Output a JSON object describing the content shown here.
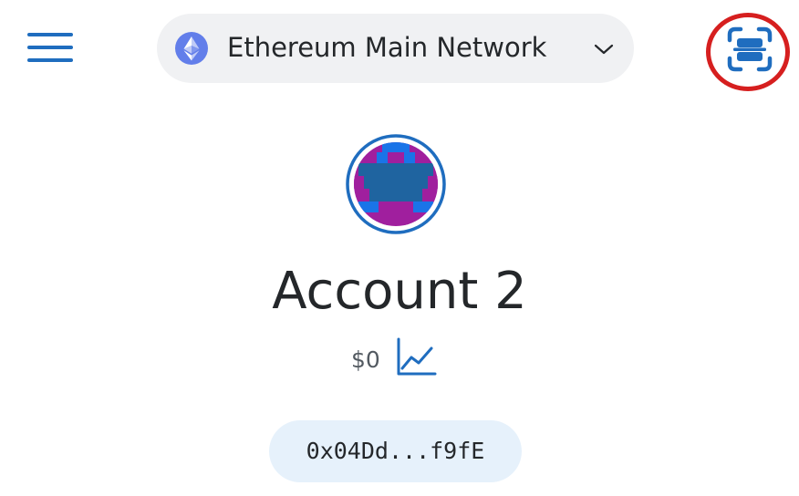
{
  "header": {
    "menu_icon": "hamburger-menu-icon",
    "network": {
      "label": "Ethereum Main Network",
      "icon": "ethereum-logo-icon",
      "dropdown_icon": "chevron-down-icon"
    },
    "scan_icon": "qr-scan-icon",
    "highlight_color": "#d61f1f"
  },
  "account": {
    "avatar_icon": "account-identicon",
    "name": "Account 2",
    "balance": "$0",
    "chart_icon": "portfolio-chart-icon",
    "address": "0x04Dd...f9fE"
  },
  "colors": {
    "accent": "#1f6dbf",
    "ethereum": "#627eea",
    "pill_background": "#f0f1f3",
    "address_background": "#e6f1fb",
    "text": "#24272a"
  }
}
